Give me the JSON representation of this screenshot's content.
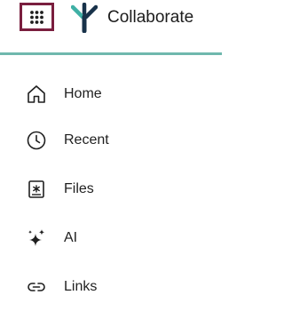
{
  "header": {
    "launcher_icon": "app-grid-icon",
    "logo_icon": "collaborate-logo-icon",
    "brand_name": "Collaborate"
  },
  "colors": {
    "launcher_border": "#7a1e3e",
    "divider": "#6fb8ad",
    "logo": "#18324a",
    "logo_accent": "#3fb0a5",
    "text": "#1f1f1f"
  },
  "sidebar": {
    "items": [
      {
        "label": "Home",
        "icon": "home-icon"
      },
      {
        "label": "Recent",
        "icon": "clock-icon"
      },
      {
        "label": "Files",
        "icon": "files-icon"
      },
      {
        "label": "AI",
        "icon": "sparkle-icon"
      },
      {
        "label": "Links",
        "icon": "link-icon"
      }
    ]
  }
}
